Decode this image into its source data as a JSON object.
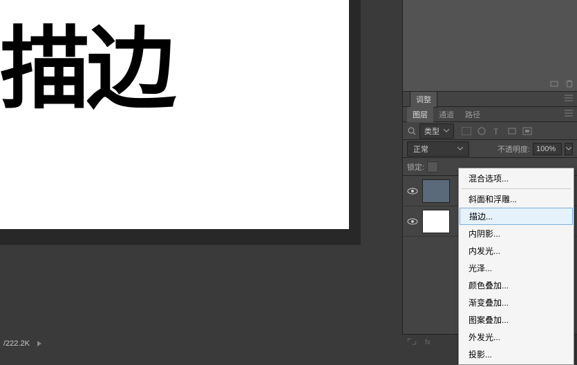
{
  "canvas": {
    "text": "描边"
  },
  "status": {
    "zoom": "/222.2K"
  },
  "panels": {
    "adjustments_tab": "调整",
    "tabs": {
      "layers": "图层",
      "channels": "通道",
      "paths": "路径"
    },
    "filter": {
      "label": "类型"
    },
    "blend": {
      "mode": "正常",
      "opacity_label": "不透明度:",
      "opacity_value": "100%"
    },
    "lock": {
      "label": "锁定:"
    }
  },
  "context_menu": {
    "items": [
      {
        "label": "混合选项...",
        "sep_after": true
      },
      {
        "label": "斜面和浮雕..."
      },
      {
        "label": "描边...",
        "highlighted": true
      },
      {
        "label": "内阴影..."
      },
      {
        "label": "内发光..."
      },
      {
        "label": "光泽..."
      },
      {
        "label": "颜色叠加..."
      },
      {
        "label": "渐变叠加..."
      },
      {
        "label": "图案叠加..."
      },
      {
        "label": "外发光..."
      },
      {
        "label": "投影..."
      }
    ]
  }
}
